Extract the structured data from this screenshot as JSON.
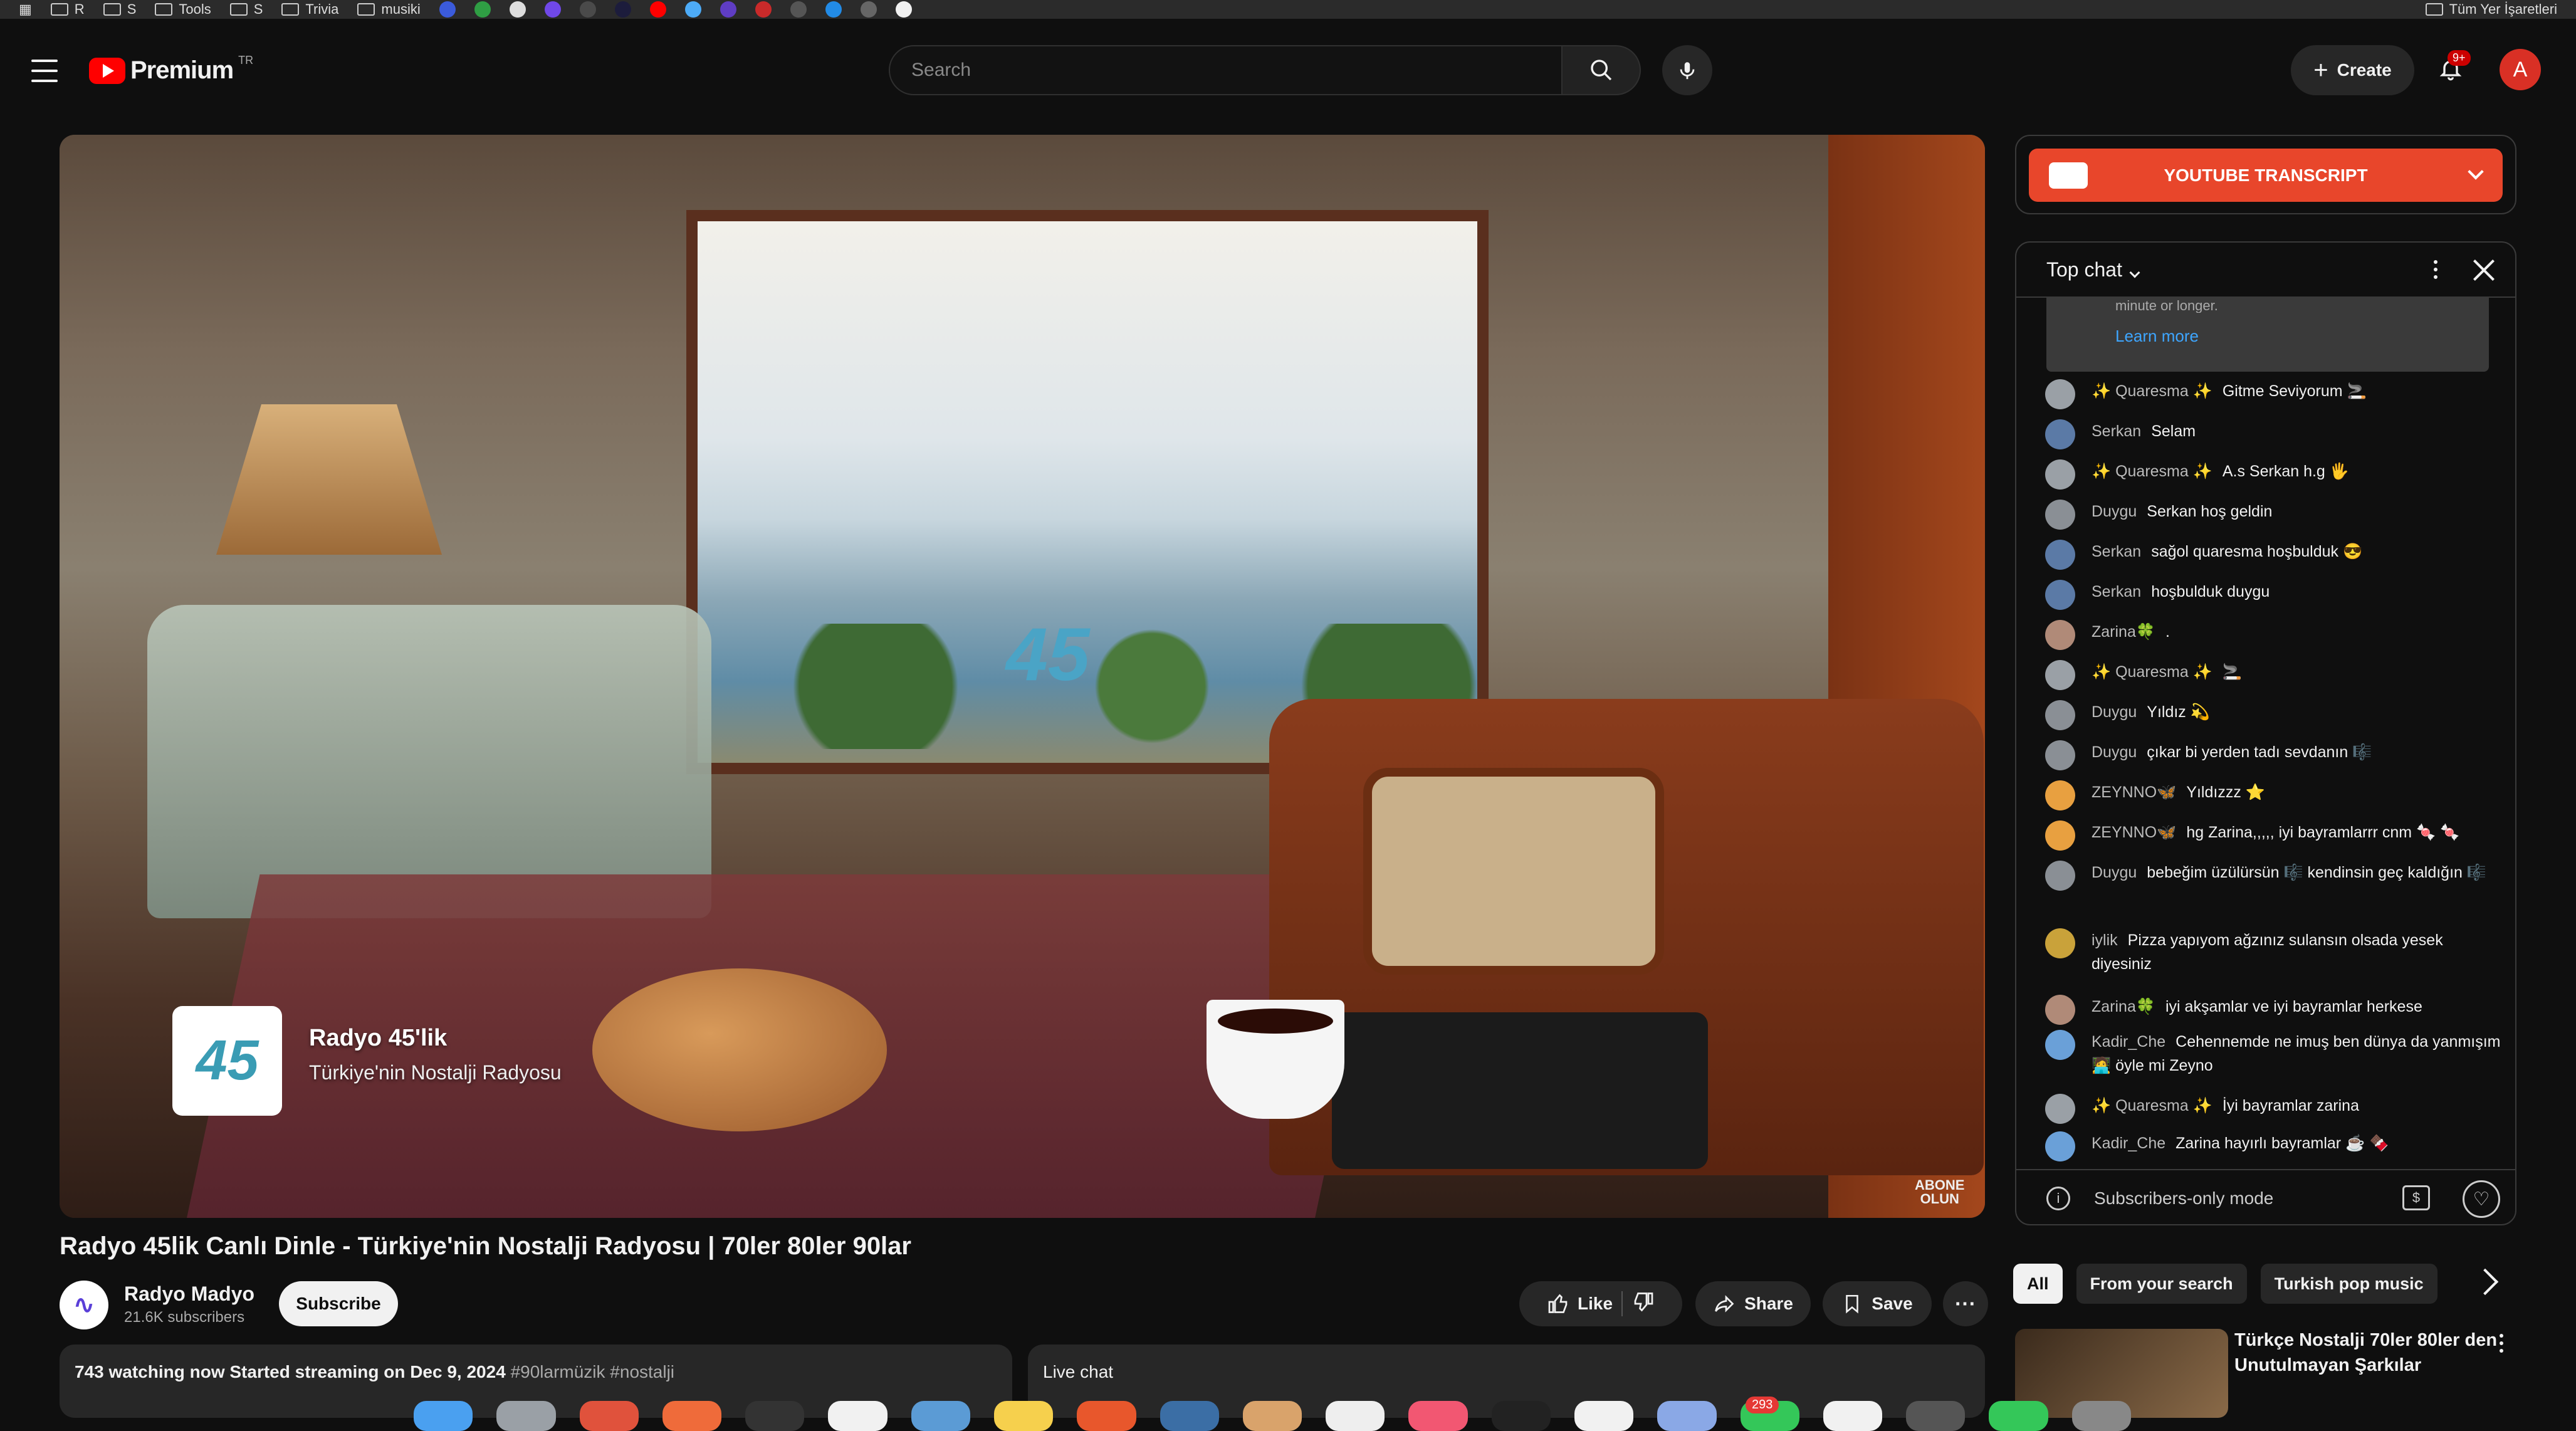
{
  "bookmarks": {
    "items": [
      "R",
      "S",
      "Tools",
      "S",
      "Trivia",
      "musiki"
    ],
    "right_label": "Tüm Yer İşaretleri"
  },
  "masthead": {
    "logo_text": "Premium",
    "country_code": "TR",
    "search_placeholder": "Search",
    "create_label": "Create",
    "notification_badge": "9+",
    "account_initial": "A"
  },
  "player": {
    "channel_card_text": "45",
    "channel_title": "Radyo 45'lik",
    "channel_subtitle": "Türkiye'nin Nostalji Radyosu",
    "watermark": "45",
    "subscribe_watermark_line1": "ABONE",
    "subscribe_watermark_line2": "OLUN"
  },
  "video": {
    "title": "Radyo 45lik Canlı Dinle - Türkiye'nin Nostalji Radyosu | 70ler 80ler 90lar",
    "channel_name": "Radyo Madyo",
    "subscribers": "21.6K subscribers",
    "subscribe_label": "Subscribe",
    "like_label": "Like",
    "share_label": "Share",
    "save_label": "Save",
    "watching": "743 watching now  Started streaming on Dec 9, 2024",
    "tags": "#90larmüzik #nostalji",
    "live_chat_label": "Live chat"
  },
  "transcript": {
    "label": "YOUTUBE TRANSCRIPT"
  },
  "chat": {
    "header": "Top chat",
    "notice_text": "minute or longer.",
    "learn_more": "Learn more",
    "messages": [
      {
        "author": "✨ Quaresma ✨",
        "text": "Gitme Seviyorum 🚬"
      },
      {
        "author": "Serkan",
        "text": "Selam"
      },
      {
        "author": "✨ Quaresma ✨",
        "text": "A.s Serkan h.g 🖐"
      },
      {
        "author": "Duygu",
        "text": "Serkan hoş geldin"
      },
      {
        "author": "Serkan",
        "text": "sağol quaresma hoşbulduk 😎"
      },
      {
        "author": "Serkan",
        "text": "hoşbulduk duygu"
      },
      {
        "author": "Zarina🍀",
        "text": "."
      },
      {
        "author": "✨ Quaresma ✨",
        "text": "🚬"
      },
      {
        "author": "Duygu",
        "text": "Yıldız 💫"
      },
      {
        "author": "Duygu",
        "text": "çıkar bi yerden tadı sevdanın 🎼"
      },
      {
        "author": "ZEYNNO🦋",
        "text": "Yıldızzz ⭐"
      },
      {
        "author": "ZEYNNO🦋",
        "text": "hg Zarina,,,,, iyi bayramlarrr cnm 🍬 🍬"
      },
      {
        "author": "Duygu",
        "text": "bebeğim üzülürsün 🎼 kendinsin geç kaldığın 🎼"
      },
      {
        "author": "iylik",
        "text": "Pizza yapıyom ağzınız sulansın olsada yesek diyesiniz"
      },
      {
        "author": "Zarina🍀",
        "text": "iyi akşamlar ve iyi bayramlar herkese"
      },
      {
        "author": "Kadir_Che",
        "text": "Cehennemde ne imuş ben dünya da yanmışım 🧑‍💻 öyle mi Zeyno"
      },
      {
        "author": "✨ Quaresma ✨",
        "text": "İyi bayramlar zarina"
      },
      {
        "author": "Kadir_Che",
        "text": "Zarina hayırlı bayramlar ☕ 🍫"
      }
    ],
    "footer": "Subscribers-only mode"
  },
  "recommendations": {
    "chips": [
      "All",
      "From your search",
      "Turkish pop music"
    ],
    "first_title": "Türkçe Nostalji 70ler 80ler den Unutulmayan Şarkılar"
  },
  "dock": {
    "badge": "293"
  },
  "colors": {
    "background": "#0f0f0f",
    "accent_red": "#ff0000",
    "transcript_orange": "#e8462b",
    "link_blue": "#3ea6ff"
  }
}
